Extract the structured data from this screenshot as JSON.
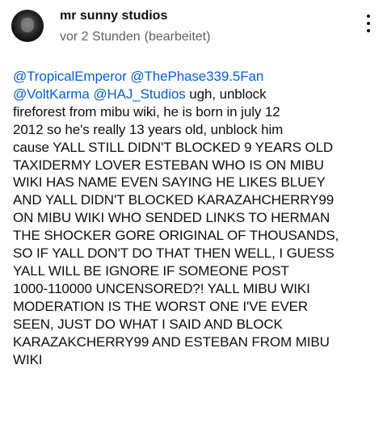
{
  "comment": {
    "author": "mr sunny studios",
    "timestamp": "vor 2 Stunden",
    "edited": "(bearbeitet)",
    "mentions": [
      "@TropicalEmperor",
      "@ThePhase339.5Fan",
      "@VoltKarma",
      "@HAJ_Studios"
    ],
    "mentions_tail": " ugh, unblock",
    "lines": [
      "fireforest from mibu wiki, he is born in july 12",
      "2012 so he's really 13 years old, unblock him",
      "cause YALL STILL DIDN'T BLOCKED 9 YEARS OLD",
      "TAXIDERMY LOVER ESTEBAN WHO IS ON MIBU",
      "WIKI HAS NAME EVEN SAYING HE LIKES BLUEY",
      "AND YALL DIDN'T BLOCKED KARAZAHCHERRY99",
      "ON MIBU WIKI WHO SENDED LINKS TO HERMAN",
      "THE SHOCKER GORE ORIGINAL OF THOUSANDS,",
      "SO IF YALL DON'T DO THAT THEN WELL, I GUESS",
      "YALL WILL BE IGNORE IF SOMEONE POST",
      "1000-110000 UNCENSORED?! YALL MIBU WIKI",
      "MODERATION IS THE WORST ONE I'VE EVER",
      "SEEN, JUST DO WHAT I SAID AND BLOCK",
      "KARAZAKCHERRY99 AND ESTEBAN FROM MIBU",
      "WIKI"
    ]
  },
  "icons": {
    "avatar": "avatar-image",
    "menu": "more-vert-icon"
  },
  "colors": {
    "mention": "#065fd4",
    "text": "#0f0f0f",
    "meta": "#606060",
    "background": "#ffffff"
  }
}
